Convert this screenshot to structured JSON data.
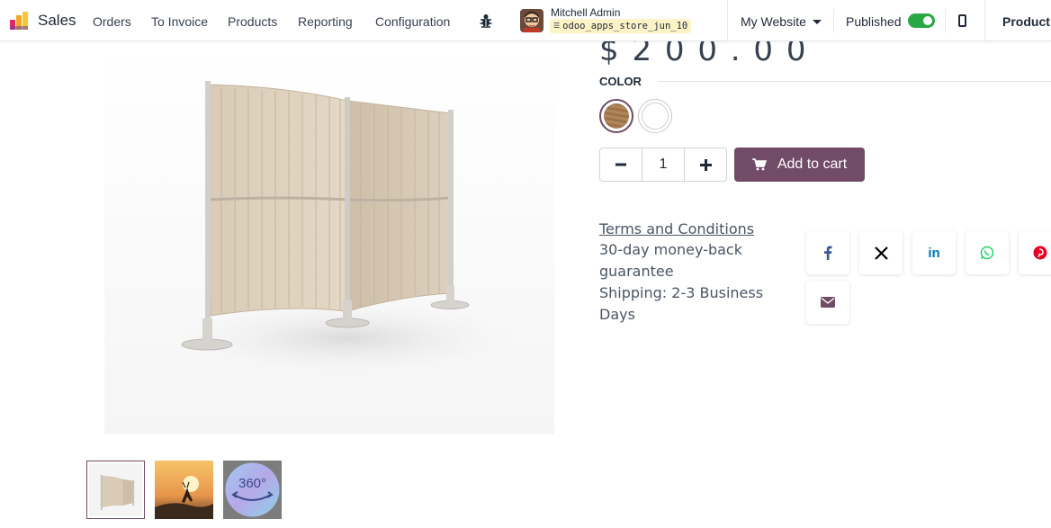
{
  "navbar": {
    "app_name": "Sales",
    "menu": [
      "Orders",
      "To Invoice",
      "Products",
      "Reporting",
      "Configuration"
    ],
    "user": {
      "name": "Mitchell Admin",
      "database": "odoo_apps_store_jun_10"
    },
    "website_selector": "My Website",
    "published_label": "Published",
    "published": true,
    "product_label": "Product"
  },
  "product": {
    "price_fragment": "$ 2 0 0 . 0 0",
    "color_label": "COLOR",
    "colors": [
      {
        "name": "wood",
        "selected": true
      },
      {
        "name": "white",
        "selected": false
      }
    ],
    "quantity": "1",
    "add_to_cart_label": "Add to cart",
    "terms_label": "Terms and Conditions",
    "info_lines": [
      "30-day money-back guarantee",
      "Shipping: 2-3 Business Days"
    ],
    "thumbnails": [
      "screen-partition",
      "sunset-deer",
      "360-view"
    ],
    "thumbnail_360_text": "360°"
  },
  "share": {
    "icons": [
      "facebook-icon",
      "x-icon",
      "linkedin-icon",
      "whatsapp-icon",
      "pinterest-icon",
      "email-icon"
    ],
    "colors": {
      "facebook": "#3b5998",
      "x": "#000000",
      "linkedin": "#0077b5",
      "whatsapp": "#25d366",
      "pinterest": "#e60023",
      "email": "#714b67"
    }
  },
  "colors": {
    "brand": "#714b67",
    "toggle_on": "#28a745",
    "db_badge_bg": "#fcf3c7"
  }
}
